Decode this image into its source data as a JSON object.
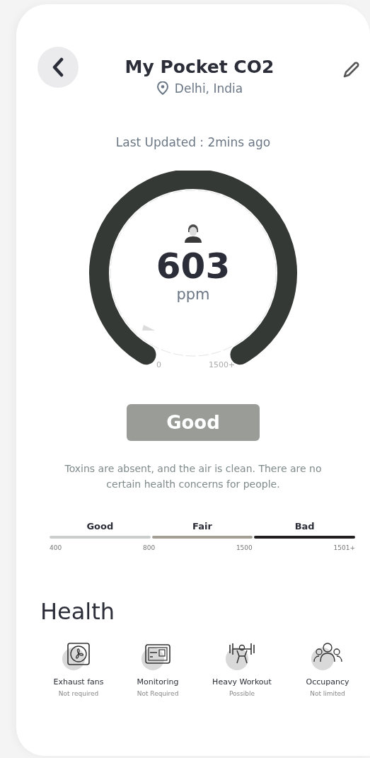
{
  "header": {
    "title": "My Pocket CO2",
    "location": "Delhi, India"
  },
  "last_updated": "Last Updated : 2mins ago",
  "gauge": {
    "value": "603",
    "unit": "ppm",
    "min_label": "0",
    "max_label": "1500+"
  },
  "status": {
    "label": "Good",
    "description": "Toxins are absent, and the air is clean. There are no certain health concerns for people."
  },
  "scale": {
    "segments": [
      {
        "label": "Good",
        "color": "#c9cecd"
      },
      {
        "label": "Fair",
        "color": "#a39f94"
      },
      {
        "label": "Bad",
        "color": "#231f20"
      }
    ],
    "ticks": [
      "400",
      "800",
      "1500",
      "1501+"
    ]
  },
  "health": {
    "title": "Health",
    "items": [
      {
        "kind": "fan",
        "name": "Exhaust fans",
        "status": "Not required"
      },
      {
        "kind": "monitor",
        "name": "Monitoring",
        "status": "Not Required"
      },
      {
        "kind": "workout",
        "name": "Heavy Workout",
        "status": "Possible"
      },
      {
        "kind": "people",
        "name": "Occupancy",
        "status": "Not limited"
      }
    ]
  }
}
